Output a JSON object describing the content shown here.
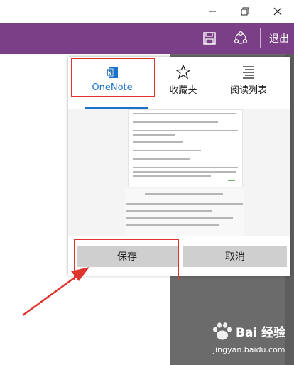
{
  "toolbar": {
    "exit_label": "退出",
    "accent_color": "#7a3f87"
  },
  "share_panel": {
    "tabs": [
      {
        "label": "OneNote",
        "icon": "onenote-icon",
        "active": true
      },
      {
        "label": "收藏夹",
        "icon": "star-icon",
        "active": false
      },
      {
        "label": "阅读列表",
        "icon": "reading-list-icon",
        "active": false
      }
    ],
    "save_label": "保存",
    "cancel_label": "取消"
  },
  "watermark": {
    "brand": "Bai 经验",
    "url": "jingyan.baidu.com"
  },
  "annotation_color": "#e0342f"
}
